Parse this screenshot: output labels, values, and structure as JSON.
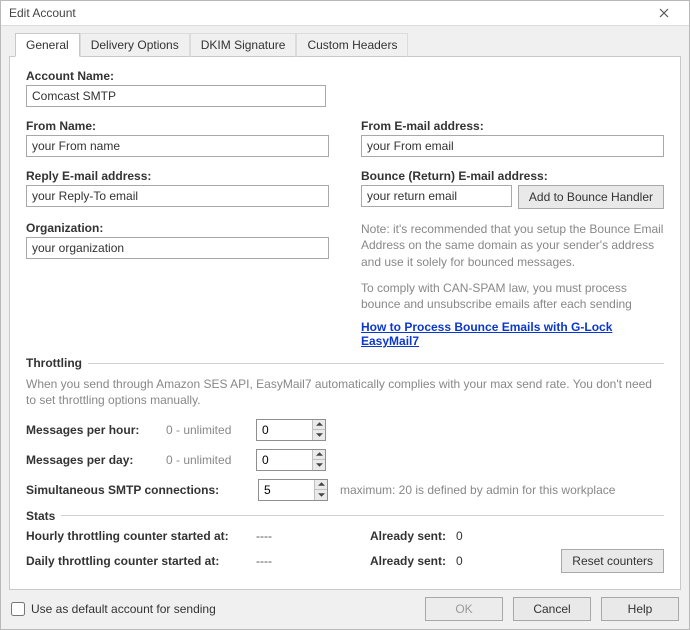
{
  "window": {
    "title": "Edit Account"
  },
  "tabs": {
    "general": "General",
    "delivery": "Delivery Options",
    "dkim": "DKIM Signature",
    "custom": "Custom Headers"
  },
  "fields": {
    "account_name": {
      "label": "Account Name:",
      "value": "Comcast SMTP"
    },
    "from_name": {
      "label": "From Name:",
      "value": "your From name"
    },
    "from_email": {
      "label": "From E-mail address:",
      "value": "your From email"
    },
    "reply_email": {
      "label": "Reply E-mail address:",
      "value": "your Reply-To email"
    },
    "organization": {
      "label": "Organization:",
      "value": "your organization"
    },
    "bounce_email": {
      "label": "Bounce (Return) E-mail address:",
      "value": "your return email"
    },
    "add_bounce_btn": "Add to Bounce Handler"
  },
  "notes": {
    "bounce1": "Note: it's recommended that you setup the Bounce Email Address on the same domain as your sender's address and use it solely for bounced messages.",
    "bounce2": "To comply with CAN-SPAM law, you must process bounce and unsubscribe emails after each sending",
    "bounce_link": "How to Process Bounce Emails with G-Lock EasyMail7"
  },
  "throttling": {
    "section": "Throttling",
    "intro": "When you send through Amazon SES API, EasyMail7 automatically complies with your max send rate. You don't need to set throttling options manually.",
    "per_hour": {
      "label": "Messages per hour:",
      "hint": "0 - unlimited",
      "value": "0"
    },
    "per_day": {
      "label": "Messages per day:",
      "hint": "0 - unlimited",
      "value": "0"
    },
    "smtp_conn": {
      "label": "Simultaneous SMTP connections:",
      "value": "5",
      "note": "maximum: 20 is defined by admin for this workplace"
    }
  },
  "stats": {
    "section": "Stats",
    "hourly_label": "Hourly throttling counter started at:",
    "hourly_val": "----",
    "daily_label": "Daily throttling counter started at:",
    "daily_val": "----",
    "already_sent_label": "Already sent:",
    "hourly_sent": "0",
    "daily_sent": "0",
    "reset_btn": "Reset counters"
  },
  "footer": {
    "default_chk": "Use as default account for sending",
    "ok": "OK",
    "cancel": "Cancel",
    "help": "Help"
  }
}
